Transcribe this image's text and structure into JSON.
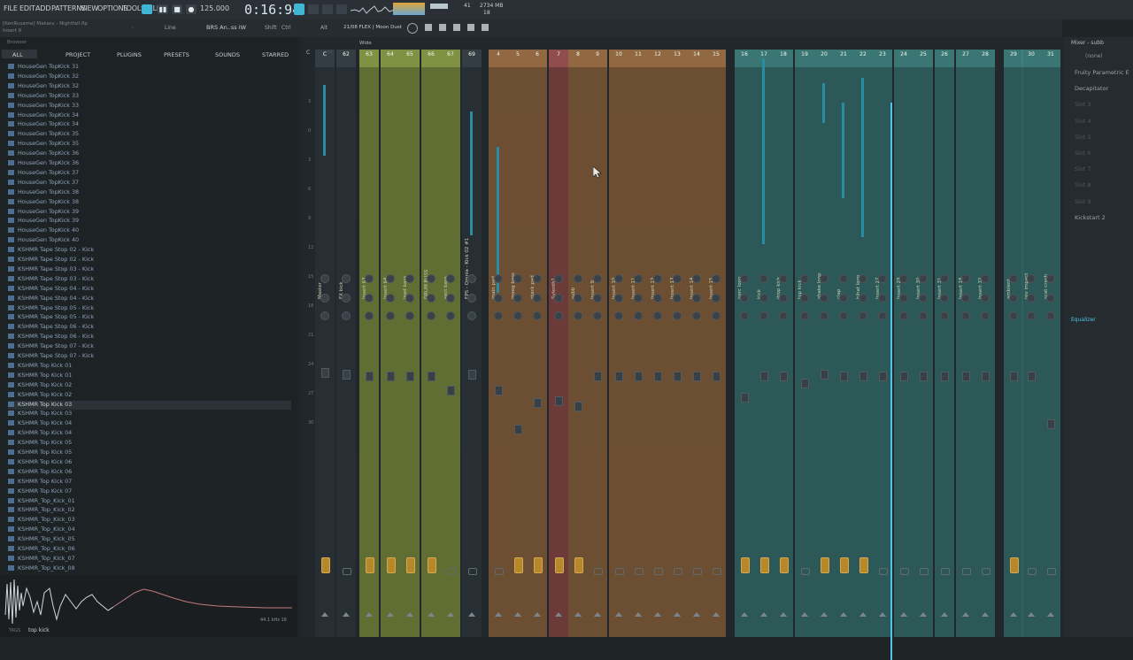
{
  "menu": [
    "FILE",
    "EDIT",
    "ADD",
    "PATTERNS",
    "VIEW",
    "OPTIONS",
    "TOOLS",
    "HELP"
  ],
  "transport": {
    "tempo": "125.000",
    "time": "0:16:94",
    "cpu_top": "41",
    "memory": "2734 MB",
    "poly": "18"
  },
  "project": {
    "file": "[KenRusama] Makaru - Nightfall.flp",
    "insert": "Insert 9"
  },
  "toolbar": {
    "snap": "Line",
    "preset": "BRS An..ss IW",
    "pattern": "21/08 FLEX | Moon Dust",
    "mixer_view": "Wide"
  },
  "browser": {
    "title": "Browser",
    "tabs": [
      "ALL",
      "PROJECT",
      "PLUGINS",
      "PRESETS",
      "SOUNDS",
      "STARRED"
    ],
    "items": [
      "HouseGen TopKick 31",
      "HouseGen TopKick 32",
      "HouseGen TopKick 32",
      "HouseGen TopKick 33",
      "HouseGen TopKick 33",
      "HouseGen TopKick 34",
      "HouseGen TopKick 34",
      "HouseGen TopKick 35",
      "HouseGen TopKick 35",
      "HouseGen TopKick 36",
      "HouseGen TopKick 36",
      "HouseGen TopKick 37",
      "HouseGen TopKick 37",
      "HouseGen TopKick 38",
      "HouseGen TopKick 38",
      "HouseGen TopKick 39",
      "HouseGen TopKick 39",
      "HouseGen TopKick 40",
      "HouseGen TopKick 40",
      "KSHMR Tape Stop 02 - Kick",
      "KSHMR Tape Stop 02 - Kick",
      "KSHMR Tape Stop 03 - Kick",
      "KSHMR Tape Stop 03 - Kick",
      "KSHMR Tape Stop 04 - Kick",
      "KSHMR Tape Stop 04 - Kick",
      "KSHMR Tape Stop 05 - Kick",
      "KSHMR Tape Stop 05 - Kick",
      "KSHMR Tape Stop 06 - Kick",
      "KSHMR Tape Stop 06 - Kick",
      "KSHMR Tape Stop 07 - Kick",
      "KSHMR Tape Stop 07 - Kick",
      "KSHMR Top Kick 01",
      "KSHMR Top Kick 01",
      "KSHMR Top Kick 02",
      "KSHMR Top Kick 02",
      "KSHMR Top Kick 03",
      "KSHMR Top Kick 03",
      "KSHMR Top Kick 04",
      "KSHMR Top Kick 04",
      "KSHMR Top Kick 05",
      "KSHMR Top Kick 05",
      "KSHMR Top Kick 06",
      "KSHMR Top Kick 06",
      "KSHMR Top Kick 07",
      "KSHMR Top Kick 07",
      "KSHMR_Top_Kick_01",
      "KSHMR_Top_Kick_02",
      "KSHMR_Top_Kick_03",
      "KSHMR_Top_Kick_04",
      "KSHMR_Top_Kick_05",
      "KSHMR_Top_Kick_06",
      "KSHMR_Top_Kick_07",
      "KSHMR_Top_Kick_08"
    ],
    "selected_index": 35
  },
  "preview": {
    "tag_label": "TAGS",
    "tag_value": "top kick",
    "info": "44.1 kHz 16"
  },
  "mixer": {
    "title": "Mixer - subb",
    "master_label": "M",
    "tracks": [
      {
        "num": "C",
        "name": "Master",
        "color": "#2a3136"
      },
      {
        "num": "62",
        "name": "FX kick",
        "color": "#2a3136"
      },
      {
        "num": "63",
        "name": "Insert 63",
        "color": "#6b7a35"
      },
      {
        "num": "64",
        "name": "Insert 64",
        "color": "#6b7a35"
      },
      {
        "num": "65",
        "name": "lead bass",
        "color": "#6b7a35"
      },
      {
        "num": "66",
        "name": "DRUM BUSS",
        "color": "#6b7a35"
      },
      {
        "num": "67",
        "name": "sect bass",
        "color": "#6b7a35"
      },
      {
        "num": "69",
        "name": "EPS - Omnia - Kick 02 #1",
        "color": "#2a3136"
      },
      {
        "num": "4",
        "name": "main pad",
        "color": "#7a5634"
      },
      {
        "num": "5",
        "name": "moog bass",
        "color": "#7a5634"
      },
      {
        "num": "6",
        "name": "stack pad",
        "color": "#7a5634"
      },
      {
        "num": "7",
        "name": "Sylenth1",
        "color": "#7a3e3c"
      },
      {
        "num": "8",
        "name": "subb",
        "color": "#7a5634"
      },
      {
        "num": "9",
        "name": "Insert 9",
        "color": "#7a5634"
      },
      {
        "num": "10",
        "name": "Insert 10",
        "color": "#7a5634"
      },
      {
        "num": "11",
        "name": "Insert 11",
        "color": "#7a5634"
      },
      {
        "num": "12",
        "name": "Insert 12",
        "color": "#7a5634"
      },
      {
        "num": "13",
        "name": "Insert 13",
        "color": "#7a5634"
      },
      {
        "num": "14",
        "name": "Insert 14",
        "color": "#7a5634"
      },
      {
        "num": "15",
        "name": "Insert 15",
        "color": "#7a5634"
      },
      {
        "num": "16",
        "name": "perc loop",
        "color": "#2f6260"
      },
      {
        "num": "17",
        "name": "kick",
        "color": "#2f6260"
      },
      {
        "num": "18",
        "name": "drop kick",
        "color": "#2f6260"
      },
      {
        "num": "19",
        "name": "top kick",
        "color": "#2f6260"
      },
      {
        "num": "20",
        "name": "shake loop",
        "color": "#2f6260"
      },
      {
        "num": "21",
        "name": "clap",
        "color": "#2f6260"
      },
      {
        "num": "22",
        "name": "hihat loop",
        "color": "#2f6260"
      },
      {
        "num": "23",
        "name": "Insert 27",
        "color": "#2f6260"
      },
      {
        "num": "24",
        "name": "Insert 29",
        "color": "#2f6260"
      },
      {
        "num": "25",
        "name": "Insert 30",
        "color": "#2f6260"
      },
      {
        "num": "26",
        "name": "Insert 31",
        "color": "#2f6260"
      },
      {
        "num": "27",
        "name": "Insert 18",
        "color": "#2f6260"
      },
      {
        "num": "28",
        "name": "Insert 32",
        "color": "#2f6260"
      },
      {
        "num": "29",
        "name": "ambient",
        "color": "#2f6260"
      },
      {
        "num": "30",
        "name": "rev impact",
        "color": "#2f6260"
      },
      {
        "num": "31",
        "name": "scat crash",
        "color": "#2f6260"
      }
    ],
    "db_labels": [
      "3",
      "0",
      "3",
      "6",
      "9",
      "12",
      "15",
      "18",
      "21",
      "24",
      "27",
      "30"
    ]
  },
  "slots": {
    "route": "(none)",
    "items": [
      {
        "label": "Fruity Parametric E",
        "active": true
      },
      {
        "label": "Decapitator",
        "active": true
      },
      {
        "label": "Slot 3",
        "active": false
      },
      {
        "label": "Slot 4",
        "active": false
      },
      {
        "label": "Slot 5",
        "active": false
      },
      {
        "label": "Slot 6",
        "active": false
      },
      {
        "label": "Slot 7",
        "active": false
      },
      {
        "label": "Slot 8",
        "active": false
      },
      {
        "label": "Slot 9",
        "active": false
      },
      {
        "label": "Kickstart 2",
        "active": true
      }
    ],
    "eq_label": "Equalizer"
  }
}
